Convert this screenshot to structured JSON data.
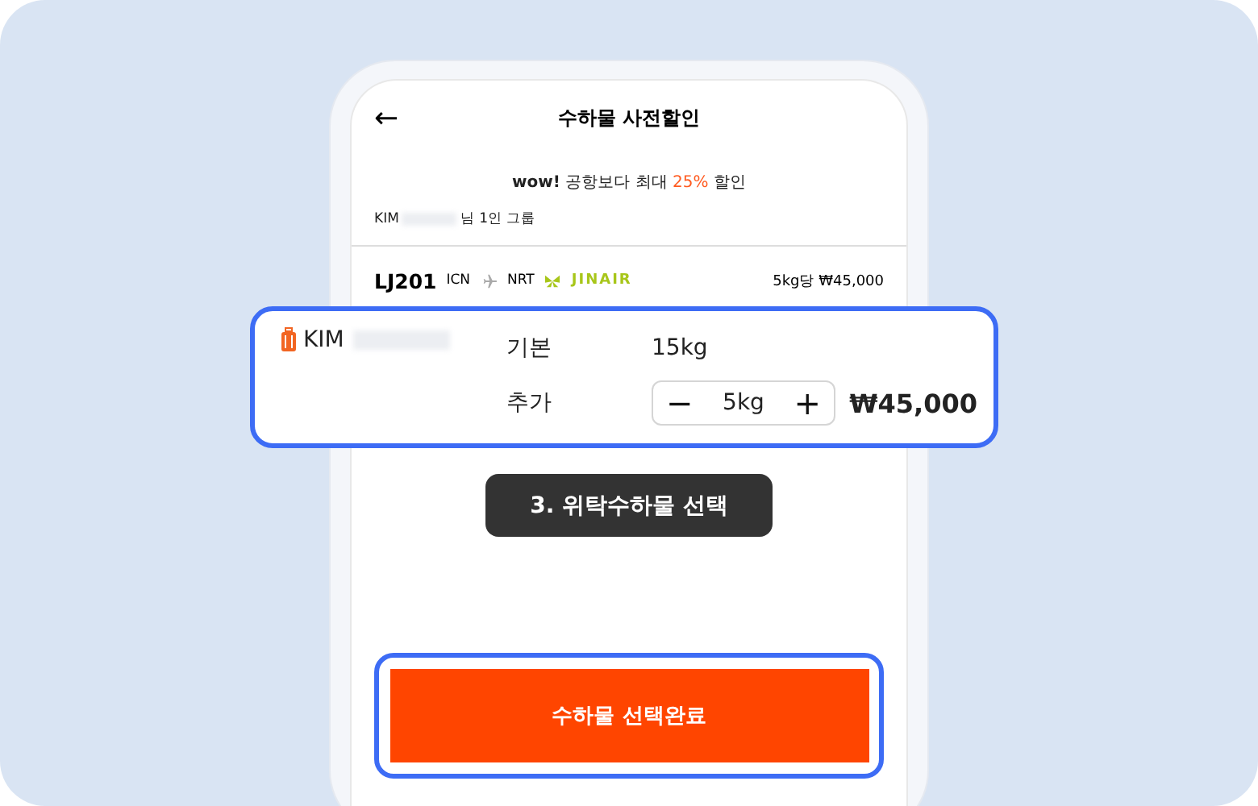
{
  "header": {
    "back": "←",
    "title": "수하물 사전할인"
  },
  "promo": {
    "lead": "**wow!** 공항보다 최대 ",
    "highlight": "25%",
    "tail": " 할인"
  },
  "group": {
    "name": "KIM",
    "suffix": "님 1인 그룹"
  },
  "flight": {
    "number": "LJ201",
    "from": "ICN",
    "to": "NRT",
    "airline": "JINAIR",
    "price": "5kg당 ₩45,000"
  },
  "passenger": {
    "name": "KIM",
    "base_label": "기본",
    "base_value": "15kg",
    "extra_label": "추가",
    "minus": "−",
    "extra_value": "5kg",
    "plus": "+",
    "total": "₩45,000"
  },
  "tooltip": "3. 위탁수하물 선택",
  "confirm_button": "수하물 선택완료"
}
